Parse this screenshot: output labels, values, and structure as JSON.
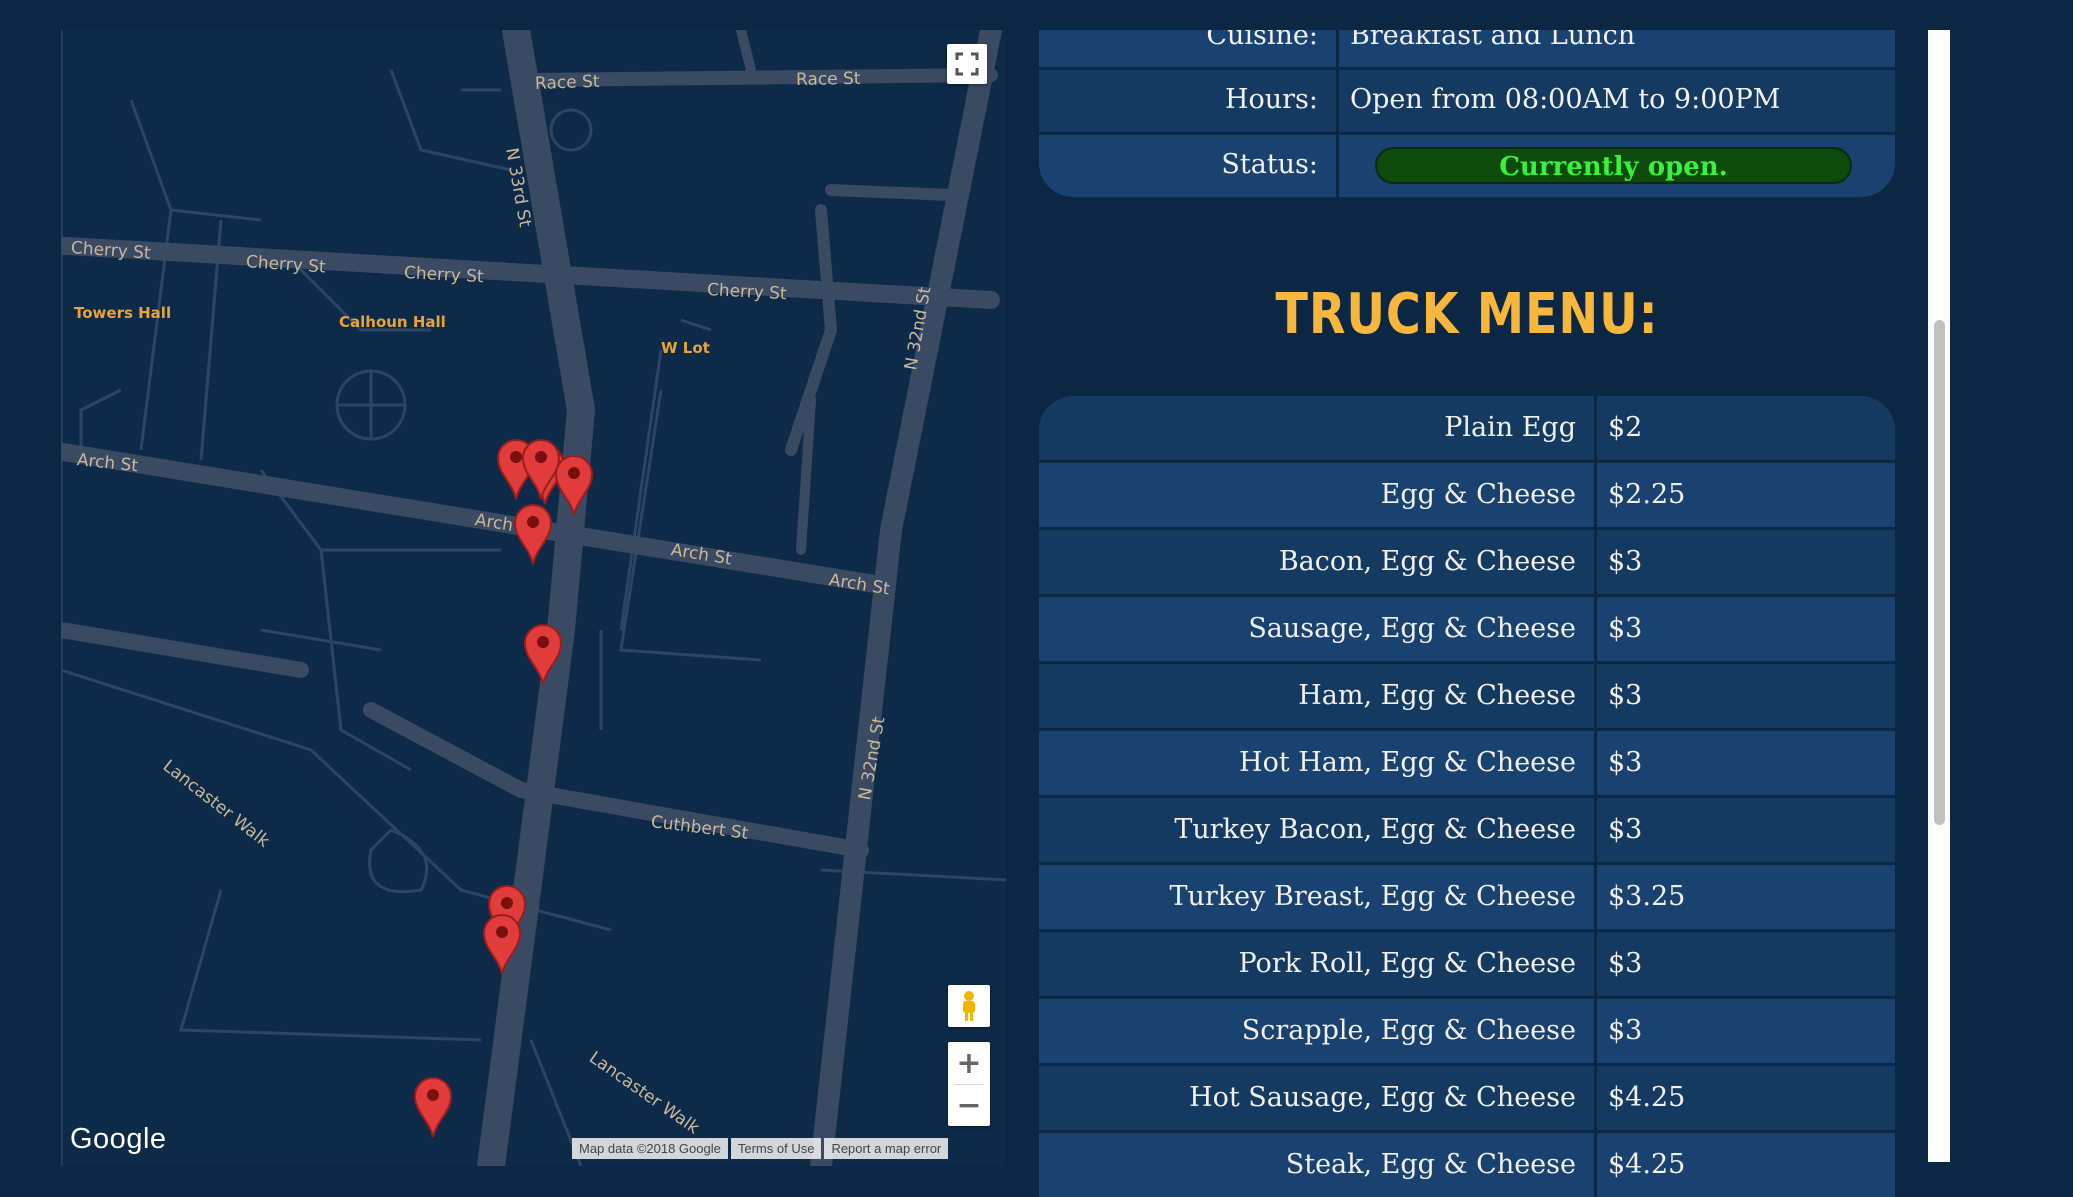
{
  "map": {
    "streets": [
      {
        "name": "Race St",
        "id": "race-st-1"
      },
      {
        "name": "Race St",
        "id": "race-st-2"
      },
      {
        "name": "Cherry St",
        "id": "cherry-st-1"
      },
      {
        "name": "Cherry St",
        "id": "cherry-st-2"
      },
      {
        "name": "Cherry St",
        "id": "cherry-st-3"
      },
      {
        "name": "Cherry St",
        "id": "cherry-st-4"
      },
      {
        "name": "Arch St",
        "id": "arch-st-1"
      },
      {
        "name": "Arch St",
        "id": "arch-st-2"
      },
      {
        "name": "Arch St",
        "id": "arch-st-3"
      },
      {
        "name": "Arch St",
        "id": "arch-st-4"
      },
      {
        "name": "N 33rd St",
        "id": "n-33rd-st"
      },
      {
        "name": "N 32nd St",
        "id": "n-32nd-st-1"
      },
      {
        "name": "N 32nd St",
        "id": "n-32nd-st-2"
      },
      {
        "name": "Cuthbert St",
        "id": "cuthbert-st"
      },
      {
        "name": "Lancaster Walk",
        "id": "lancaster-walk-1"
      },
      {
        "name": "Lancaster Walk",
        "id": "lancaster-walk-2"
      }
    ],
    "pois": [
      {
        "name": "Towers Hall"
      },
      {
        "name": "Calhoun Hall"
      },
      {
        "name": "W Lot"
      }
    ],
    "pin_count": 9,
    "logo": "Google",
    "attribution": [
      "Map data ©2018 Google",
      "Terms of Use",
      "Report a map error"
    ],
    "zoom_in": "+",
    "zoom_out": "−",
    "icons": [
      "fullscreen-icon",
      "pegman-icon",
      "map-pin-icon"
    ]
  },
  "info": {
    "cuisine_label": "Cuisine:",
    "cuisine_value": "Breakfast and Lunch",
    "hours_label": "Hours:",
    "hours_value": "Open from 08:00AM to 9:00PM",
    "status_label": "Status:",
    "status_value": "Currently open."
  },
  "menu": {
    "title": "TRUCK MENU:",
    "items": [
      {
        "name": "Plain Egg",
        "price": "$2"
      },
      {
        "name": "Egg & Cheese",
        "price": "$2.25"
      },
      {
        "name": "Bacon, Egg & Cheese",
        "price": "$3"
      },
      {
        "name": "Sausage, Egg & Cheese",
        "price": "$3"
      },
      {
        "name": "Ham, Egg & Cheese",
        "price": "$3"
      },
      {
        "name": "Hot Ham, Egg & Cheese",
        "price": "$3"
      },
      {
        "name": "Turkey Bacon, Egg & Cheese",
        "price": "$3"
      },
      {
        "name": "Turkey Breast, Egg & Cheese",
        "price": "$3.25"
      },
      {
        "name": "Pork Roll, Egg & Cheese",
        "price": "$3"
      },
      {
        "name": "Scrapple, Egg & Cheese",
        "price": "$3"
      },
      {
        "name": "Hot Sausage, Egg & Cheese",
        "price": "$4.25"
      },
      {
        "name": "Steak, Egg & Cheese",
        "price": "$4.25"
      }
    ]
  },
  "colors": {
    "page_bg": "#0b2744",
    "accent_title": "#f6b73c",
    "status_text": "#38f23b",
    "status_bg": "#0d4a0c",
    "pin": "#e23b3b"
  }
}
